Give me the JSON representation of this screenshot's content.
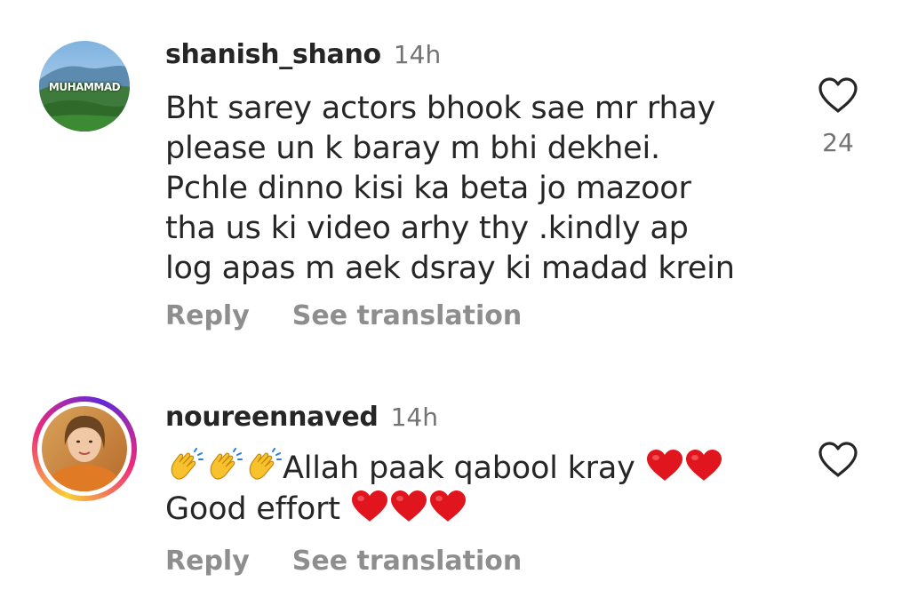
{
  "comments": [
    {
      "username": "shanish_shano",
      "time": "14h",
      "avatar_text": "MUHAMMAD",
      "lines": [
        "Bht sarey actors bhook sae mr rhay",
        "please un k baray m bhi dekhei.",
        "Pchle dinno kisi ka beta jo mazoor",
        "tha us ki video arhy thy .kindly ap",
        "log apas m aek dsray ki madad krein"
      ],
      "like_count": "24",
      "like_icon": "heart-outline-icon",
      "reply_label": "Reply",
      "translate_label": "See translation"
    },
    {
      "username": "noureennaved",
      "time": "14h",
      "has_story_ring": true,
      "line1_emojis": [
        "clapping-hands",
        "clapping-hands",
        "clapping-hands"
      ],
      "line1_text": "Allah paak qabool kray",
      "line1_trailing_emojis": [
        "red-heart",
        "red-heart"
      ],
      "line2_text": "Good effort",
      "line2_trailing_emojis": [
        "red-heart",
        "red-heart",
        "red-heart"
      ],
      "like_icon": "heart-outline-icon",
      "reply_label": "Reply",
      "translate_label": "See translation"
    }
  ],
  "colors": {
    "text": "#262626",
    "secondary": "#737373",
    "action": "#8e8e8e",
    "heart": "#e0151e"
  }
}
